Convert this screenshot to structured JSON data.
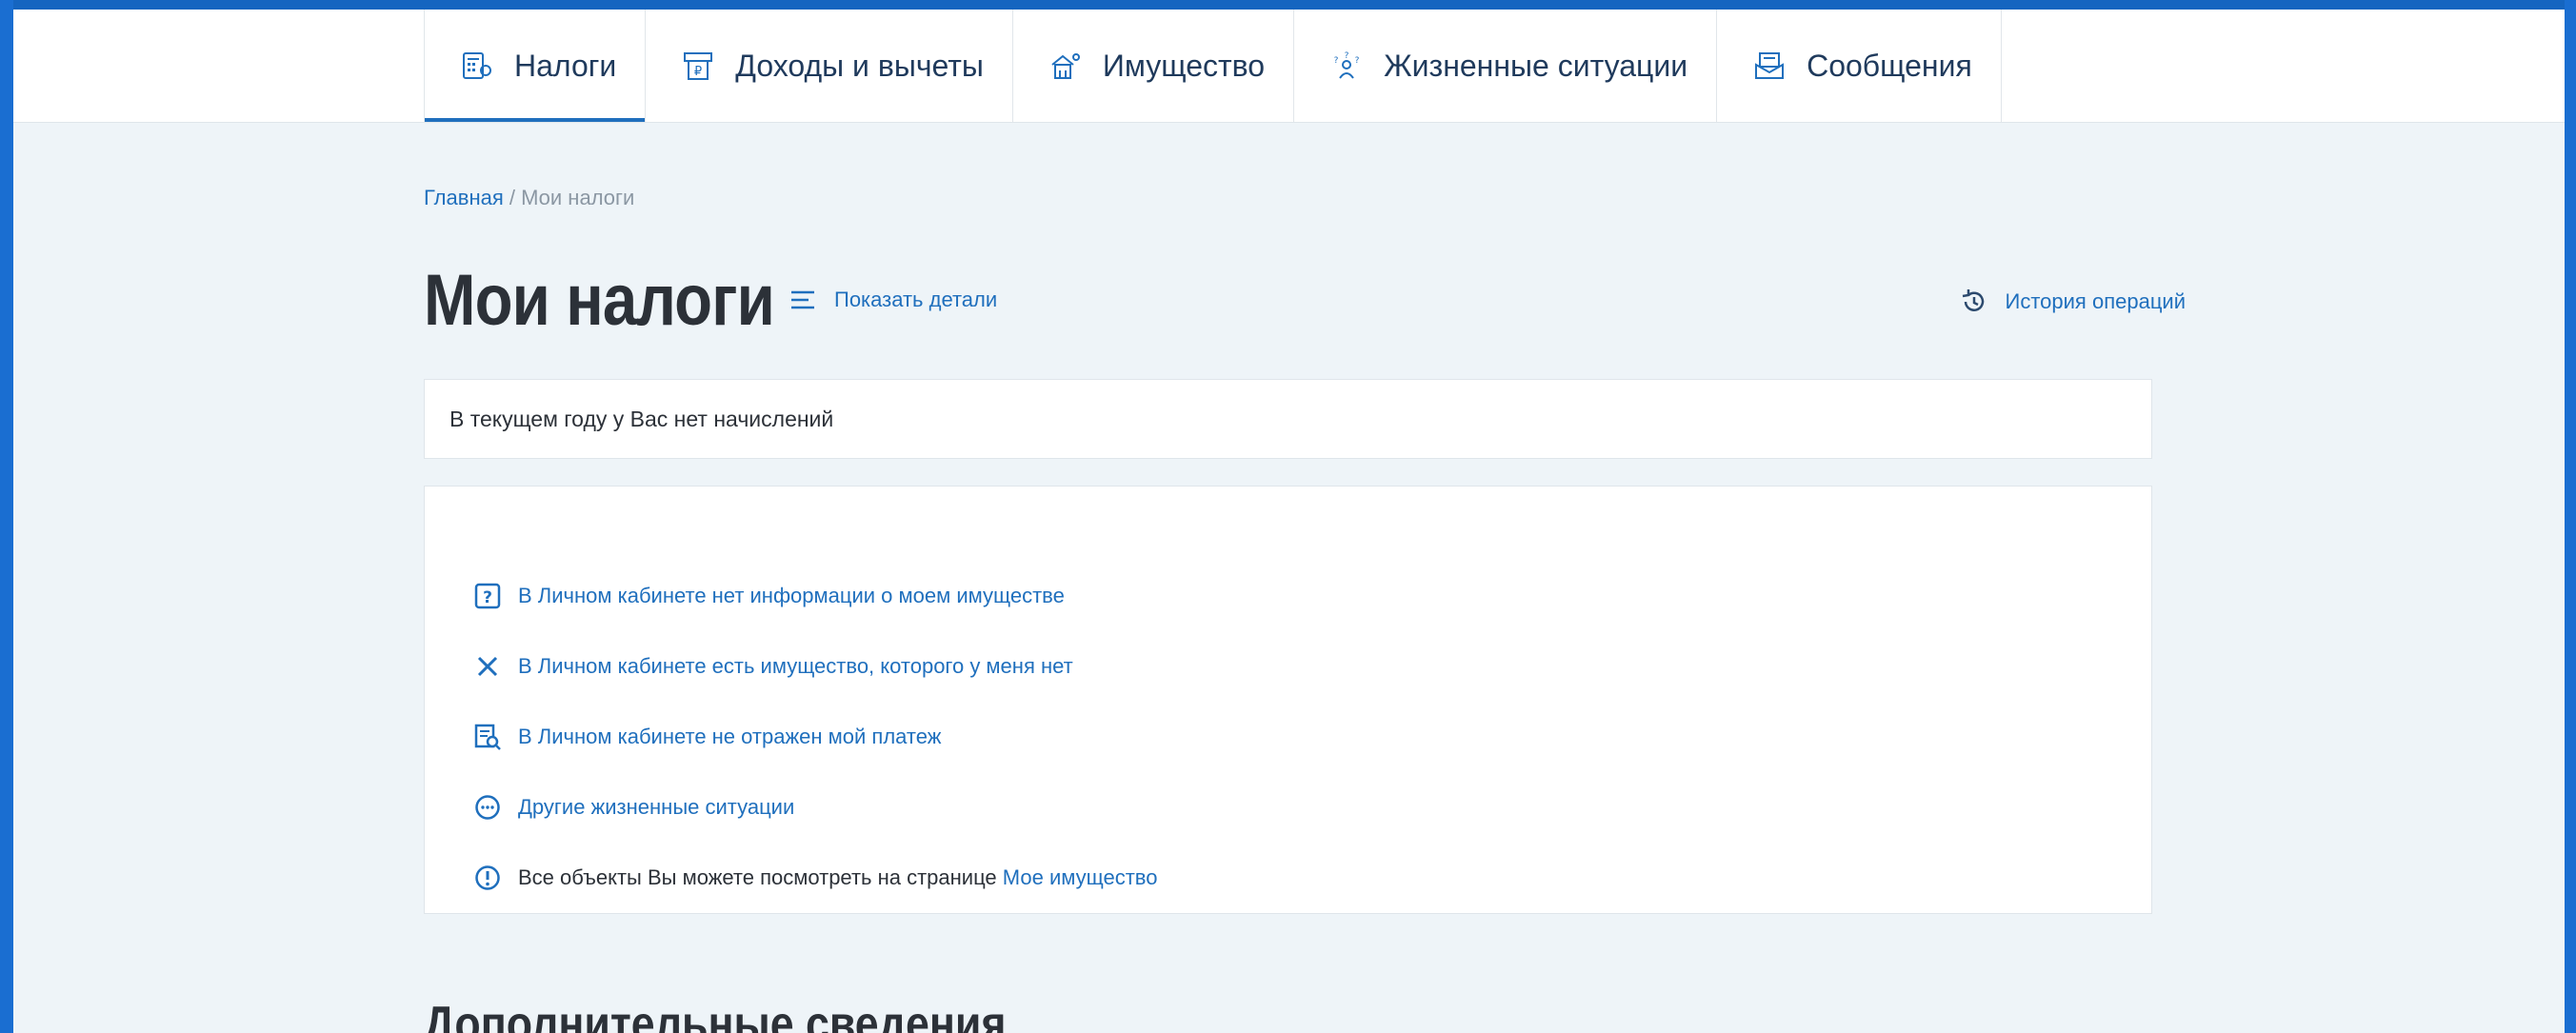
{
  "nav": {
    "tabs": [
      {
        "label": "Налоги",
        "icon": "taxes-icon",
        "active": true
      },
      {
        "label": "Доходы и вычеты",
        "icon": "income-icon",
        "active": false
      },
      {
        "label": "Имущество",
        "icon": "property-icon",
        "active": false
      },
      {
        "label": "Жизненные ситуации",
        "icon": "life-situations-icon",
        "active": false
      },
      {
        "label": "Сообщения",
        "icon": "messages-icon",
        "active": false
      }
    ]
  },
  "breadcrumb": {
    "home": "Главная",
    "separator": " / ",
    "current": "Мои налоги"
  },
  "page": {
    "title": "Мои налоги",
    "details_link": "Показать детали",
    "history_link": "История операций"
  },
  "info_bar": {
    "text": "В текущем году у Вас нет начислений"
  },
  "situations": [
    {
      "icon": "question-icon",
      "label": "В Личном кабинете нет информации о моем имуществе"
    },
    {
      "icon": "close-icon",
      "label": "В Личном кабинете есть имущество, которого у меня нет"
    },
    {
      "icon": "payment-search-icon",
      "label": "В Личном кабинете не отражен мой платеж"
    },
    {
      "icon": "more-icon",
      "label": "Другие жизненные ситуации"
    }
  ],
  "notice": {
    "icon": "info-icon",
    "text": "Все объекты Вы можете посмотреть на странице ",
    "link": "Мое имущество"
  },
  "section": {
    "title": "Дополнительные сведения"
  },
  "colors": {
    "accent": "#1f6fbd",
    "text": "#2c3138",
    "background": "#eef4f8",
    "frame": "#1565c0"
  }
}
